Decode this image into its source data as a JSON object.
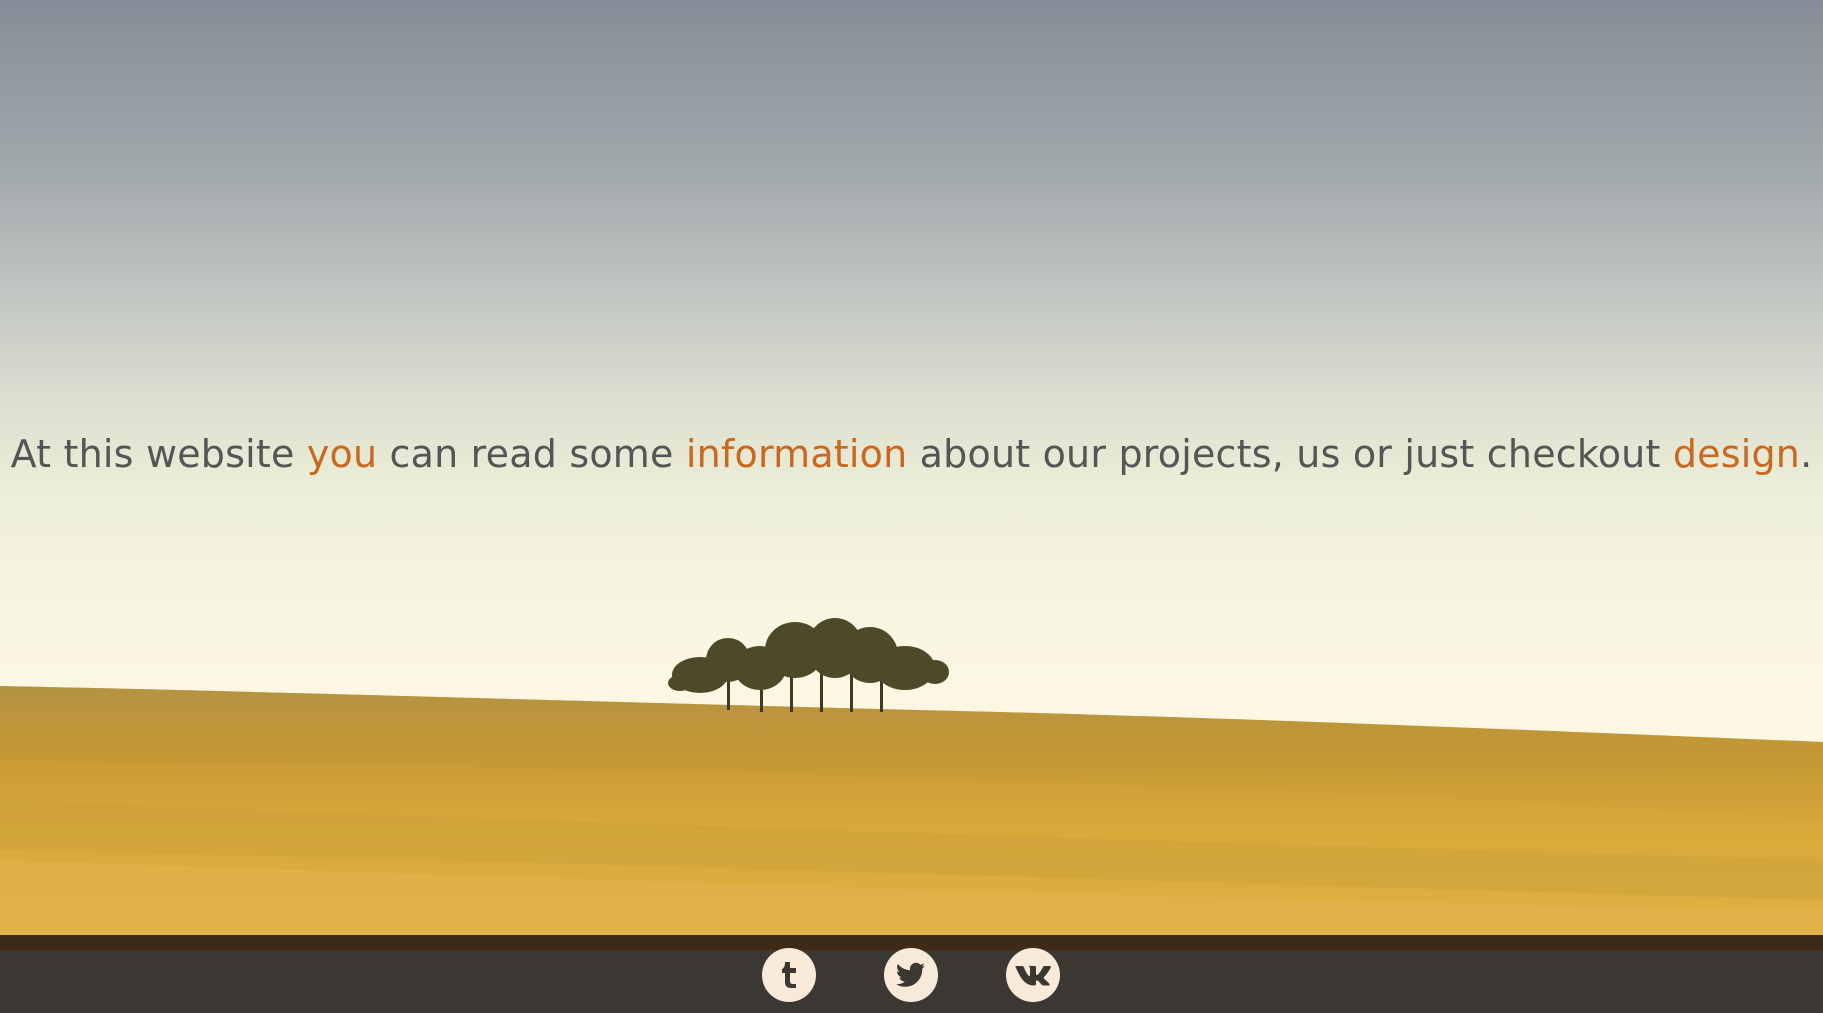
{
  "hero": {
    "tagline": {
      "part1": "At this website ",
      "accent1": "you",
      "part2": " can read some ",
      "accent2": "information",
      "part3": " about our projects, us or just checkout ",
      "accent3": "design",
      "part4": "."
    }
  },
  "social": [
    {
      "name": "tumblr",
      "icon": "tumblr-icon"
    },
    {
      "name": "twitter",
      "icon": "twitter-icon"
    },
    {
      "name": "vk",
      "icon": "vk-icon"
    }
  ],
  "colors": {
    "accent": "#c9681f",
    "text": "#555555",
    "footer": "#3b3834",
    "icon_bg": "#f8ead8",
    "icon_fg": "#3b3834"
  }
}
